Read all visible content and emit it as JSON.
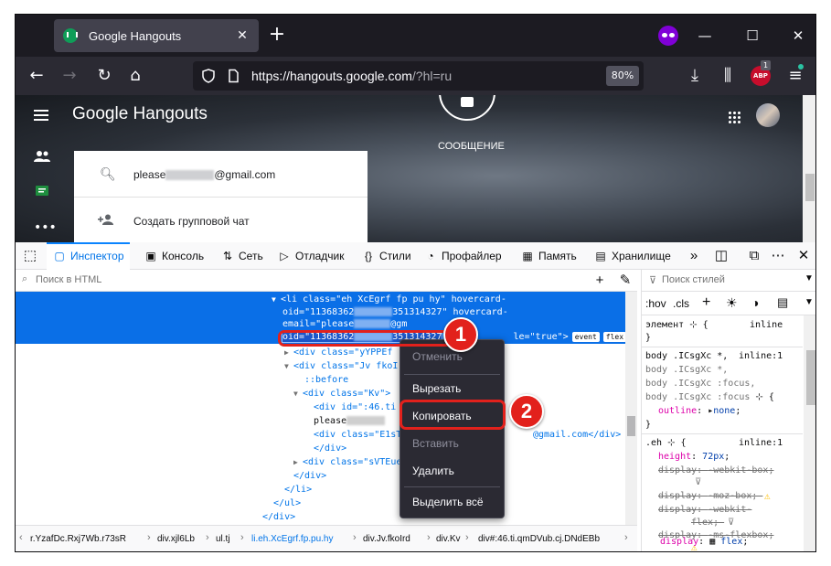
{
  "browser": {
    "tab_title": "Google Hangouts",
    "tab_close": "✕",
    "new_tab": "+",
    "window_controls": [
      "—",
      "☐",
      "✕"
    ],
    "url_host": "https://hangouts.google.com",
    "url_rest": "/?hl=ru",
    "zoom": "80%",
    "abp_label": "ABP",
    "extension_badge": "1",
    "accent_private": "#8000d7"
  },
  "hangouts": {
    "logo": "Google Hangouts",
    "message_label": "СООБЩЕНИЕ",
    "email_prefix": "please",
    "email_suffix": "@gmail.com",
    "create_group": "Создать групповой чат"
  },
  "devtools": {
    "tabs": {
      "inspector": "Инспектор",
      "console": "Консоль",
      "network": "Сеть",
      "debugger": "Отладчик",
      "styles": "Стили",
      "profiler": "Профайлер",
      "memory": "Память",
      "storage": "Хранилище"
    },
    "search_html_placeholder": "Поиск в HTML",
    "search_styles_placeholder": "Поиск стилей",
    "hov": ":hov",
    "cls": ".cls",
    "markup": {
      "line1": "<li class=\"eh XcEgrf fp pu hy\" hovercard-",
      "line2a": "oid=\"11368362",
      "line2b": "351314327\" hovercard-",
      "line3a": "email=\"please",
      "line3b": "@gm",
      "line4a": "oid=\"11368362",
      "line4b": "351314327",
      "line4c": "le=\"true\">",
      "badge_event": "event",
      "badge_flex": "flex",
      "line5": "<div class=\"yYPPEf ",
      "line6": "<div class=\"Jv fkoIr",
      "line7": "::before",
      "line8": "<div class=\"Kv\">",
      "line9": "<div id=\":46.ti",
      "line10": "please",
      "line11": "<div class=\"E1sT",
      "line11b": "@gmail.com</div>",
      "line12": "</div>",
      "line13": "<div class=\"sVTEue",
      "line14": "</div>",
      "line15": "</li>",
      "line16": "</ul>",
      "line17": "</div>"
    },
    "breadcrumbs": [
      "r.YzafDc.Rxj7Wb.r73sR",
      "div.xjl6Lb",
      "ul.tj",
      "li.eh.XcEgrf.fp.pu.hy",
      "div.Jv.fkoIrd",
      "div.Kv",
      "div#:46.ti.qmDVub.cj.DNdEBb"
    ],
    "styles": {
      "element": "элемент",
      "inline": "inline",
      "inline1": "inline:1",
      "r1_sel1": "body .ICsgXc *,",
      "r1_sel2": "body .ICsgXc *,",
      "r1_sel3": "body .ICsgXc :focus,",
      "r1_sel4": "body .ICsgXc :focus",
      "outline": "outline",
      "none": "none",
      "r2_sel": ".eh",
      "height": "height",
      "height_val": "72px",
      "display": "display",
      "webkit_box": "-webkit-box",
      "moz_box": "-moz-box",
      "webkit_flex_a": "-webkit-",
      "webkit_flex_b": "flex",
      "ms_flexbox": "-ms-flexbox",
      "flex": "flex"
    }
  },
  "context_menu": {
    "undo": "Отменить",
    "cut": "Вырезать",
    "copy": "Копировать",
    "paste": "Вставить",
    "delete": "Удалить",
    "select_all": "Выделить всё"
  },
  "annotations": {
    "step1": "1",
    "step2": "2",
    "color": "#e2211c"
  }
}
